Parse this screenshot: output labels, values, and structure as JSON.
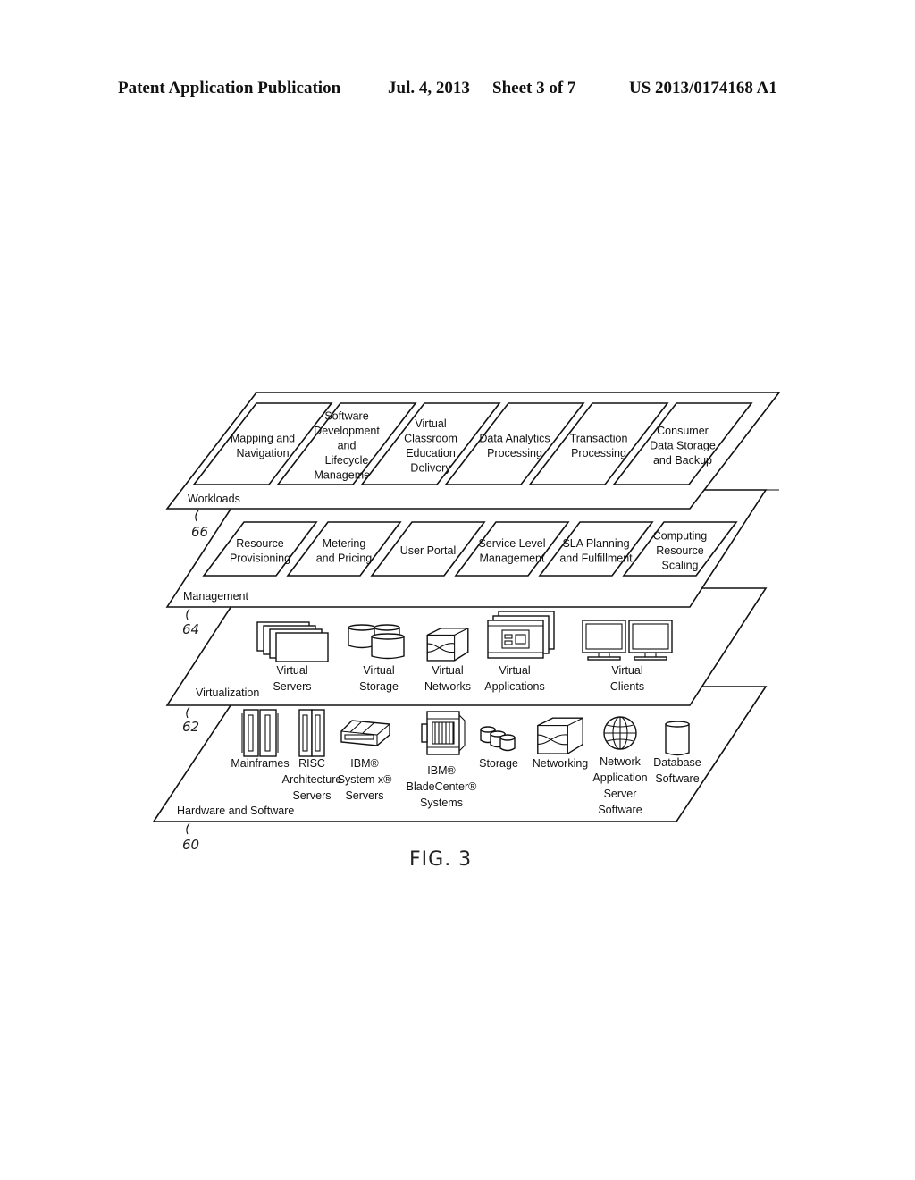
{
  "header": {
    "publication": "Patent Application Publication",
    "date": "Jul. 4, 2013",
    "sheet": "Sheet 3 of 7",
    "number": "US 2013/0174168 A1"
  },
  "figure_label": "FIG. 3",
  "layers": [
    {
      "id": "workloads",
      "name": "Workloads",
      "ref": "66",
      "items": [
        {
          "lines": [
            "Mapping and",
            "Navigation"
          ]
        },
        {
          "lines": [
            "Software",
            "Development",
            "and",
            "Lifecycle",
            "Management"
          ]
        },
        {
          "lines": [
            "Virtual",
            "Classroom",
            "Education",
            "Delivery"
          ]
        },
        {
          "lines": [
            "Data Analytics",
            "Processing"
          ]
        },
        {
          "lines": [
            "Transaction",
            "Processing"
          ]
        },
        {
          "lines": [
            "Consumer",
            "Data Storage",
            "and Backup"
          ]
        }
      ]
    },
    {
      "id": "management",
      "name": "Management",
      "ref": "64",
      "items": [
        {
          "lines": [
            "Resource",
            "Provisioning"
          ]
        },
        {
          "lines": [
            "Metering",
            "and Pricing"
          ]
        },
        {
          "lines": [
            "User Portal"
          ]
        },
        {
          "lines": [
            "Service Level",
            "Management"
          ]
        },
        {
          "lines": [
            "SLA Planning",
            "and Fulfillment"
          ]
        },
        {
          "lines": [
            "Computing",
            "Resource",
            "Scaling"
          ]
        }
      ]
    },
    {
      "id": "virtualization",
      "name": "Virtualization",
      "ref": "62",
      "items": [
        {
          "icon": "virtual-servers-icon",
          "lines": [
            "Virtual",
            "Servers"
          ]
        },
        {
          "icon": "virtual-storage-icon",
          "lines": [
            "Virtual",
            "Storage"
          ]
        },
        {
          "icon": "virtual-networks-icon",
          "lines": [
            "Virtual",
            "Networks"
          ]
        },
        {
          "icon": "virtual-applications-icon",
          "lines": [
            "Virtual",
            "Applications"
          ]
        },
        {
          "icon": "virtual-clients-icon",
          "lines": [
            "Virtual",
            "Clients"
          ]
        }
      ]
    },
    {
      "id": "hardware-software",
      "name": "Hardware and Software",
      "ref": "60",
      "items": [
        {
          "icon": "mainframe-icon",
          "lines": [
            "Mainframes"
          ]
        },
        {
          "icon": "risc-server-icon",
          "lines": [
            "RISC",
            "Architecture",
            "Servers"
          ]
        },
        {
          "icon": "system-x-server-icon",
          "lines": [
            "IBM®",
            "System x®",
            "Servers"
          ]
        },
        {
          "icon": "bladecenter-icon",
          "lines": [
            "IBM®",
            "BladeCenter®",
            "Systems"
          ]
        },
        {
          "icon": "storage-icon",
          "lines": [
            "Storage"
          ]
        },
        {
          "icon": "networking-icon",
          "lines": [
            "Networking"
          ]
        },
        {
          "icon": "globe-icon",
          "lines": [
            "Network",
            "Application",
            "Server",
            "Software"
          ]
        },
        {
          "icon": "database-icon",
          "lines": [
            "Database",
            "Software"
          ]
        }
      ]
    }
  ]
}
